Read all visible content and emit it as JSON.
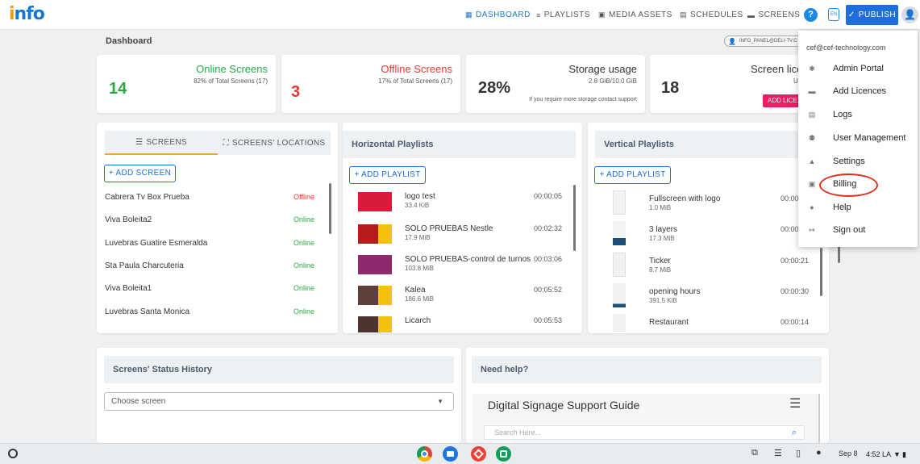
{
  "app": {
    "logo_main": "nfo",
    "logo_dot": "i"
  },
  "nav": {
    "dashboard": "DASHBOARD",
    "playlists": "PLAYLISTS",
    "media_assets": "MEDIA ASSETS",
    "schedules": "SCHEDULES",
    "screens": "SCREENS",
    "help": "?",
    "lang": "EN",
    "publish": "PUBLISH"
  },
  "breadcrumb": "Dashboard",
  "email_chip": "INFO_PANEL@DELI-TV.C",
  "stats": {
    "online": {
      "value": "14",
      "title": "Online Screens",
      "sub": "82% of Total Screens (17)"
    },
    "offline": {
      "value": "3",
      "title": "Offline Screens",
      "sub": "17% of Total Screens (17)"
    },
    "storage": {
      "value": "28%",
      "title": "Storage usage",
      "sub": "2.8 GiB/10.0 GiB",
      "note": "If you require more storage contact support"
    },
    "licences": {
      "value": "18",
      "title": "Screen lice",
      "sub": "U",
      "button": "ADD LICE"
    }
  },
  "screens_panel": {
    "tab_screens": "SCREENS",
    "tab_locations": "SCREENS' LOCATIONS",
    "add_button": "+ ADD SCREEN",
    "rows": [
      {
        "name": "Cabrera Tv Box Prueba",
        "status": "Offline"
      },
      {
        "name": "Viva Boleita2",
        "status": "Online"
      },
      {
        "name": "Luvebras Guatire Esmeralda",
        "status": "Online"
      },
      {
        "name": "Sta Paula Charcuteria",
        "status": "Online"
      },
      {
        "name": "Viva Boleita1",
        "status": "Online"
      },
      {
        "name": "Luvebras Santa Monica",
        "status": "Online"
      }
    ]
  },
  "horizontal": {
    "title": "Horizontal Playlists",
    "add_button": "+ ADD PLAYLIST",
    "rows": [
      {
        "name": "logo test",
        "size": "33.4 KiB",
        "duration": "00:00:05"
      },
      {
        "name": "SOLO PRUEBAS Nestle",
        "size": "17.9 MiB",
        "duration": "00:02:32"
      },
      {
        "name": "SOLO PRUEBAS-control de turnos",
        "size": "103.8 MiB",
        "duration": "00:03:06"
      },
      {
        "name": "Kalea",
        "size": "186.6 MiB",
        "duration": "00:05:52"
      },
      {
        "name": "Licarch",
        "size": "",
        "duration": "00:05:53"
      }
    ]
  },
  "vertical": {
    "title": "Vertical Playlists",
    "add_button": "+ ADD PLAYLIST",
    "rows": [
      {
        "name": "Fullscreen with logo",
        "size": "1.0 MiB",
        "duration": "00:00:"
      },
      {
        "name": "3 layers",
        "size": "17.3 MiB",
        "duration": "00:00:"
      },
      {
        "name": "Ticker",
        "size": "8.7 MiB",
        "duration": "00:00:21"
      },
      {
        "name": "opening hours",
        "size": "391.5 KiB",
        "duration": "00:00:30"
      },
      {
        "name": "Restaurant",
        "size": "",
        "duration": "00:00:14"
      }
    ]
  },
  "status_history": {
    "title": "Screens' Status History",
    "select_placeholder": "Choose screen"
  },
  "help_panel": {
    "title": "Need help?",
    "guide_title": "Digital Signage Support Guide",
    "search_placeholder": "Search Here..."
  },
  "user_menu": {
    "email": "cef@cef-technology.com",
    "items": [
      {
        "label": "Admin Portal",
        "icon": "gear-icon"
      },
      {
        "label": "Add Licences",
        "icon": "card-icon"
      },
      {
        "label": "Logs",
        "icon": "logs-icon"
      },
      {
        "label": "User Management",
        "icon": "users-icon"
      },
      {
        "label": "Settings",
        "icon": "person-icon"
      },
      {
        "label": "Billing",
        "icon": "billing-icon"
      },
      {
        "label": "Help",
        "icon": "help-icon"
      },
      {
        "label": "Sign out",
        "icon": "signout-icon"
      }
    ]
  },
  "taskbar": {
    "date": "Sep 8",
    "time": "4:52 LA"
  },
  "colors": {
    "accent": "#1e6fd9",
    "online": "#27a844",
    "offline": "#e53935",
    "licence_button": "#e91e63"
  }
}
